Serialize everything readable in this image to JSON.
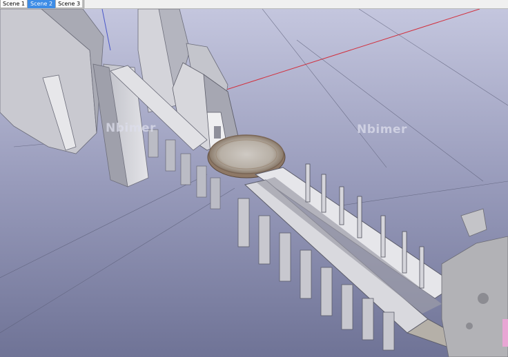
{
  "scene_tabs": [
    {
      "label": "Scene 1",
      "active": false
    },
    {
      "label": "Scene 2",
      "active": true
    },
    {
      "label": "Scene 3",
      "active": false
    }
  ],
  "viewport": {
    "watermarks": [
      "Nbimer",
      "Nbimer"
    ],
    "colors": {
      "sky_top": "#b9bbd6",
      "sky_bottom": "#6f7396",
      "axis_red": "#d22f3c",
      "stone": "#cfcfd4",
      "stone_shadow": "#7e7f8c"
    }
  }
}
